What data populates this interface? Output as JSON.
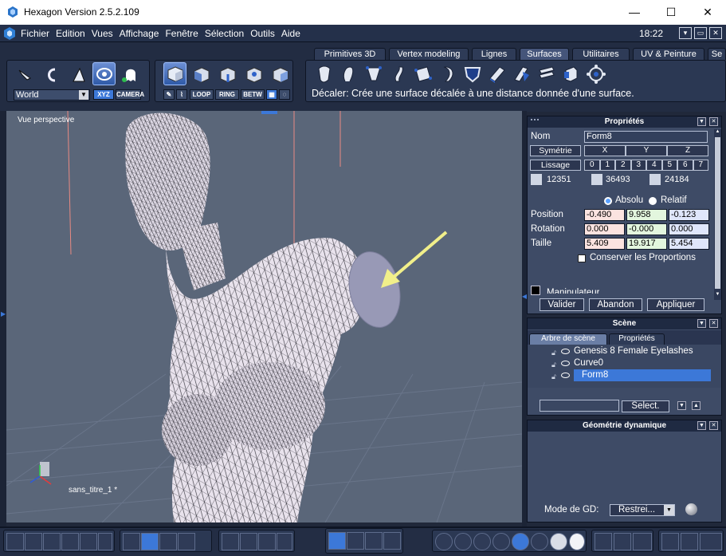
{
  "window": {
    "title": "Hexagon Version 2.5.2.109",
    "minimize": "—",
    "maximize": "☐",
    "close": "✕"
  },
  "menu": [
    "Fichier",
    "Edition",
    "Vues",
    "Affichage",
    "Fenêtre",
    "Sélection",
    "Outils",
    "Aide"
  ],
  "clock": "18:22",
  "mdi": [
    "▾",
    "▭",
    "✕"
  ],
  "toolbar": {
    "coord_select": "World",
    "xyz": "XYZ",
    "camera": "CAMERA",
    "sel_modes": [
      "LOOP",
      "RING",
      "BETW"
    ],
    "status": "Décaler: Crée une surface décalée à une distance donnée d'une surface."
  },
  "tabs": [
    "Primitives 3D",
    "Vertex modeling",
    "Lignes",
    "Surfaces",
    "Utilitaires",
    "UV & Peinture",
    "Se"
  ],
  "active_tab": "Surfaces",
  "viewport": {
    "label": "Vue perspective",
    "scene_name": "sans_titre_1 *"
  },
  "properties": {
    "title": "Propriétés",
    "name_label": "Nom",
    "name_value": "Form8",
    "symmetry_label": "Symétrie",
    "axes": [
      "X",
      "Y",
      "Z"
    ],
    "smooth_label": "Lissage",
    "smooth_levels": [
      "0",
      "1",
      "2",
      "3",
      "4",
      "5",
      "6",
      "7"
    ],
    "counts": [
      "12351",
      "36493",
      "24184"
    ],
    "absolute": "Absolu",
    "relative": "Relatif",
    "position_label": "Position",
    "position": [
      "-0.490",
      "9.958",
      "-0.123"
    ],
    "rotation_label": "Rotation",
    "rotation": [
      "0.000",
      "-0.000",
      "0.000"
    ],
    "size_label": "Taille",
    "size": [
      "5.409",
      "19.917",
      "5.454"
    ],
    "keep_proportions": "Conserver les Proportions",
    "manipulator": "Manipulateur",
    "validate": "Valider",
    "cancel": "Abandon",
    "apply": "Appliquer"
  },
  "scene": {
    "title": "Scène",
    "tab_tree": "Arbre de scène",
    "tab_props": "Propriétés",
    "items": [
      "Genesis 8 Female Eyelashes",
      "Curve0",
      "Form8"
    ],
    "selected": "Form8",
    "select_button": "Select."
  },
  "dyn_geo": {
    "title": "Géométrie dynamique",
    "mode_label": "Mode de GD:",
    "mode_value": "Restrei..."
  },
  "colors": {
    "accent": "#3c78d8",
    "viewport_bg": "#5a6679",
    "arrow": "#f1ef8a"
  }
}
